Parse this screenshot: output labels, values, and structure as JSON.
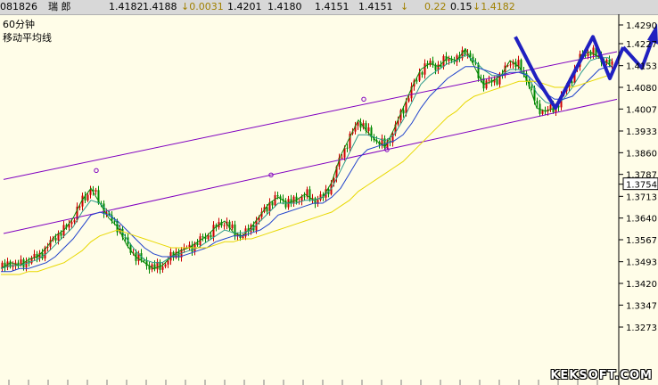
{
  "infobar": {
    "code": "081826",
    "name": "瑞  郎",
    "open": "1.4182",
    "high": "1.4188",
    "change": "↓0.0031",
    "v1": "1.4201",
    "v2": "1.4180",
    "v3": "1.4151",
    "v4": "1.4151",
    "arrow": "↓",
    "v5": "0.22",
    "v6": "0.15",
    "last": "↓1.4182"
  },
  "labels": {
    "period": "60分钟",
    "indicator": "移动平均线"
  },
  "watermark": "KEKSOFT.COM",
  "chart_data": {
    "type": "line",
    "ylim": [
      1.318,
      1.429
    ],
    "y_ticks": [
      "1.4290",
      "1.4227",
      "1.4153",
      "1.4080",
      "1.4007",
      "1.3933",
      "1.3860",
      "1.3787",
      "1.3754",
      "1.3713",
      "1.3640",
      "1.3567",
      "1.3493",
      "1.3420",
      "1.3347",
      "1.3273"
    ],
    "highlight_tick": "1.3754",
    "x": [
      1,
      12,
      22,
      32,
      42,
      52,
      62,
      72,
      82,
      92,
      102,
      112,
      122,
      132,
      142,
      152,
      162,
      172,
      182,
      192,
      202,
      212,
      222,
      232,
      242,
      252,
      262,
      272,
      282,
      292,
      302,
      312,
      322,
      332,
      342,
      352,
      362,
      372,
      382,
      392,
      402,
      412,
      422,
      432,
      442,
      452,
      462,
      472,
      482,
      492,
      502,
      512,
      522,
      532,
      542,
      552,
      562,
      572,
      582,
      592,
      602,
      612,
      622,
      632,
      642,
      652,
      662,
      672,
      682,
      686
    ],
    "series": [
      {
        "values": [
          1.347,
          1.349,
          1.348,
          1.35,
          1.351,
          1.354,
          1.358,
          1.36,
          1.364,
          1.37,
          1.374,
          1.369,
          1.364,
          1.361,
          1.355,
          1.351,
          1.349,
          1.347,
          1.348,
          1.351,
          1.353,
          1.354,
          1.356,
          1.358,
          1.361,
          1.363,
          1.359,
          1.358,
          1.361,
          1.365,
          1.369,
          1.371,
          1.369,
          1.37,
          1.372,
          1.37,
          1.371,
          1.376,
          1.385,
          1.391,
          1.397,
          1.393,
          1.39,
          1.388,
          1.394,
          1.401,
          1.408,
          1.414,
          1.416,
          1.415,
          1.418,
          1.417,
          1.421,
          1.415,
          1.409,
          1.41,
          1.412,
          1.417,
          1.415,
          1.41,
          1.401,
          1.4,
          1.401,
          1.406,
          1.412,
          1.419,
          1.42,
          1.418,
          1.416,
          1.415
        ]
      },
      {
        "values": [
          1.347,
          1.348,
          1.348,
          1.349,
          1.35,
          1.352,
          1.355,
          1.358,
          1.361,
          1.366,
          1.37,
          1.369,
          1.366,
          1.362,
          1.357,
          1.353,
          1.35,
          1.349,
          1.349,
          1.351,
          1.352,
          1.353,
          1.354,
          1.356,
          1.358,
          1.36,
          1.359,
          1.359,
          1.36,
          1.363,
          1.366,
          1.369,
          1.369,
          1.369,
          1.37,
          1.37,
          1.371,
          1.374,
          1.38,
          1.386,
          1.392,
          1.392,
          1.391,
          1.39,
          1.392,
          1.397,
          1.403,
          1.409,
          1.412,
          1.414,
          1.416,
          1.417,
          1.419,
          1.417,
          1.414,
          1.412,
          1.412,
          1.414,
          1.414,
          1.412,
          1.406,
          1.403,
          1.402,
          1.404,
          1.408,
          1.413,
          1.417,
          1.418,
          1.418,
          1.417
        ]
      },
      {
        "values": [
          1.346,
          1.346,
          1.347,
          1.347,
          1.348,
          1.349,
          1.351,
          1.354,
          1.357,
          1.361,
          1.365,
          1.366,
          1.365,
          1.363,
          1.36,
          1.357,
          1.354,
          1.352,
          1.351,
          1.351,
          1.351,
          1.352,
          1.353,
          1.354,
          1.356,
          1.357,
          1.358,
          1.358,
          1.359,
          1.36,
          1.362,
          1.365,
          1.366,
          1.367,
          1.368,
          1.369,
          1.369,
          1.371,
          1.374,
          1.379,
          1.384,
          1.387,
          1.388,
          1.389,
          1.39,
          1.392,
          1.396,
          1.401,
          1.405,
          1.408,
          1.411,
          1.413,
          1.415,
          1.415,
          1.414,
          1.413,
          1.412,
          1.413,
          1.413,
          1.412,
          1.409,
          1.406,
          1.404,
          1.404,
          1.405,
          1.408,
          1.411,
          1.414,
          1.415,
          1.415
        ]
      },
      {
        "values": [
          1.345,
          1.345,
          1.345,
          1.346,
          1.346,
          1.347,
          1.348,
          1.349,
          1.351,
          1.353,
          1.356,
          1.358,
          1.359,
          1.36,
          1.359,
          1.358,
          1.357,
          1.356,
          1.355,
          1.354,
          1.354,
          1.354,
          1.354,
          1.354,
          1.355,
          1.356,
          1.356,
          1.357,
          1.357,
          1.358,
          1.359,
          1.36,
          1.361,
          1.362,
          1.363,
          1.364,
          1.365,
          1.366,
          1.368,
          1.37,
          1.373,
          1.375,
          1.377,
          1.379,
          1.381,
          1.383,
          1.386,
          1.389,
          1.392,
          1.395,
          1.398,
          1.4,
          1.403,
          1.405,
          1.406,
          1.407,
          1.408,
          1.409,
          1.41,
          1.41,
          1.41,
          1.409,
          1.408,
          1.408,
          1.408,
          1.409,
          1.41,
          1.411,
          1.412,
          1.412
        ]
      }
    ],
    "series_colors": [
      "#0a8a0a",
      "#2a9a8a",
      "#2244cc",
      "#e8d800"
    ],
    "candle_color_up": "#cc0000",
    "candle_color_down": "#008800",
    "channel_color": "#8000c0",
    "arrow_color": "#2020c0"
  }
}
